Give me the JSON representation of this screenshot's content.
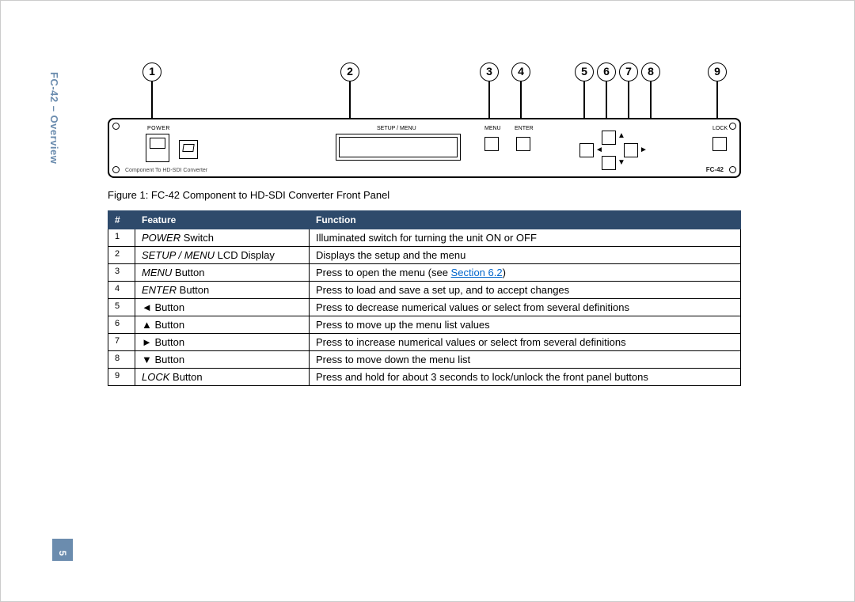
{
  "sidebar": {
    "title": "FC-42 – Overview",
    "page": "5"
  },
  "callouts": [
    "1",
    "2",
    "3",
    "4",
    "5",
    "6",
    "7",
    "8",
    "9"
  ],
  "panel": {
    "power_label": "POWER",
    "lcd_label": "SETUP / MENU",
    "menu_label": "MENU",
    "enter_label": "ENTER",
    "lock_label": "LOCK",
    "subtitle": "Component To HD-SDI Converter",
    "model": "FC-42"
  },
  "caption": "Figure 1: FC-42 Component to HD-SDI Converter Front Panel",
  "table": {
    "headers": {
      "num": "#",
      "feature": "Feature",
      "function": "Function"
    },
    "rows": [
      {
        "num": "1",
        "feat_i": "POWER",
        "feat_r": " Switch",
        "func": "Illuminated switch for turning the unit ON or OFF"
      },
      {
        "num": "2",
        "feat_i": "SETUP / MENU",
        "feat_r": " LCD Display",
        "func": "Displays the setup and the menu"
      },
      {
        "num": "3",
        "feat_i": "MENU",
        "feat_r": " Button",
        "func_pre": "Press to open the menu (see ",
        "func_link": "Section 6.2",
        "func_post": ")"
      },
      {
        "num": "4",
        "feat_i": "ENTER",
        "feat_r": " Button",
        "func": "Press to load and save a set up, and to accept changes"
      },
      {
        "num": "5",
        "arrow": "◄",
        "feat_r": " Button",
        "func": "Press to decrease numerical values or select from several definitions"
      },
      {
        "num": "6",
        "arrow": "▲",
        "feat_r": " Button",
        "func": "Press to move up the menu list values"
      },
      {
        "num": "7",
        "arrow": "►",
        "feat_r": " Button",
        "func": "Press to increase numerical values or select from several definitions"
      },
      {
        "num": "8",
        "arrow": "▼",
        "feat_r": " Button",
        "func": "Press to move down the menu list"
      },
      {
        "num": "9",
        "feat_i": "LOCK",
        "feat_r": " Button",
        "func": "Press and hold for about 3 seconds to lock/unlock the front panel buttons"
      }
    ]
  }
}
